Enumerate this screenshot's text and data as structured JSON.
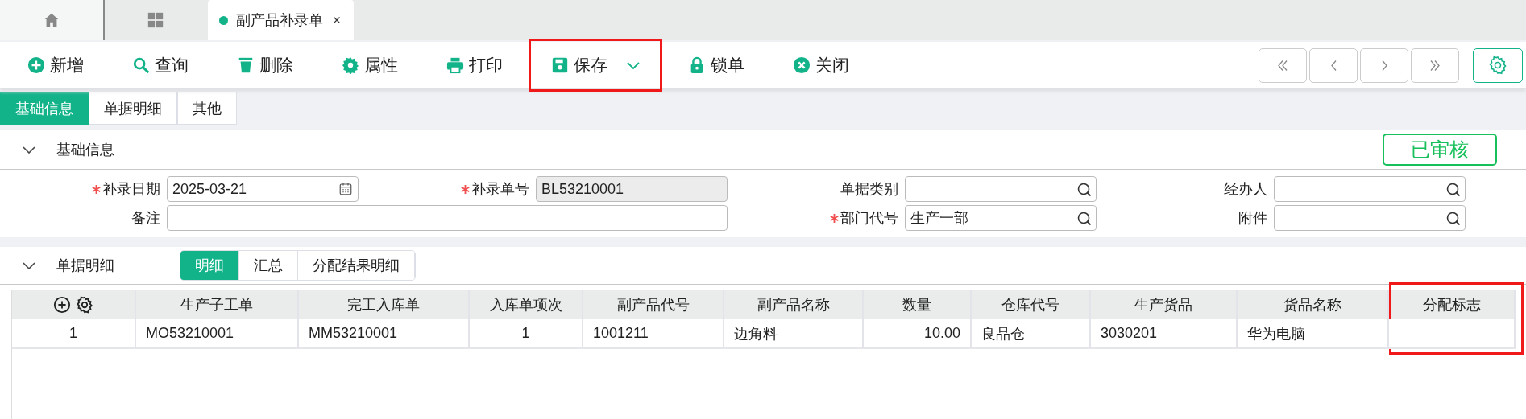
{
  "tabs": [
    {
      "kind": "home",
      "selected": false
    },
    {
      "kind": "grid",
      "selected": false
    },
    {
      "kind": "page",
      "label": "副产品补录单",
      "selected": true
    }
  ],
  "toolbar": [
    {
      "kind": "add",
      "label": "新增"
    },
    {
      "kind": "search",
      "label": "查询"
    },
    {
      "kind": "delete",
      "label": "删除"
    },
    {
      "kind": "properties",
      "label": "属性"
    },
    {
      "kind": "print",
      "label": "打印"
    },
    {
      "kind": "save",
      "label": "保存",
      "dropdown": true,
      "highlighted": true
    },
    {
      "kind": "lock",
      "label": "锁单"
    },
    {
      "kind": "close",
      "label": "关闭"
    }
  ],
  "nav_buttons": [
    {
      "kind": "first"
    },
    {
      "kind": "prev"
    },
    {
      "kind": "next"
    },
    {
      "kind": "last"
    }
  ],
  "section_tabs": [
    {
      "label": "基础信息",
      "selected": true
    },
    {
      "label": "单据明细",
      "selected": false
    },
    {
      "label": "其他",
      "selected": false
    }
  ],
  "basic_info": {
    "title": "基础信息",
    "expanded": true,
    "status": "已审核",
    "fields": [
      {
        "label": "补录日期",
        "required": true,
        "kind": "date",
        "value": "2025-03-21"
      },
      {
        "label": "补录单号",
        "required": true,
        "kind": "readonly",
        "value": "BL53210001"
      },
      {
        "label": "单据类别",
        "required": false,
        "kind": "lookup"
      },
      {
        "label": "经办人",
        "required": false,
        "kind": "lookup"
      },
      {
        "label": "备注",
        "required": false,
        "kind": "text",
        "wide": true
      },
      {
        "label": "部门代号",
        "required": true,
        "kind": "lookup",
        "value": "生产一部"
      },
      {
        "label": "附件",
        "required": false,
        "kind": "lookup"
      }
    ]
  },
  "details": {
    "title": "单据明细",
    "expanded": true,
    "tabs": [
      {
        "label": "明细",
        "selected": true
      },
      {
        "label": "汇总",
        "selected": false
      },
      {
        "label": "分配结果明细",
        "selected": false
      }
    ],
    "table": {
      "columns": [
        {
          "kind": "tools"
        },
        {
          "label": "生产子工单"
        },
        {
          "label": "完工入库单"
        },
        {
          "label": "入库单项次"
        },
        {
          "label": "副产品代号"
        },
        {
          "label": "副产品名称"
        },
        {
          "label": "数量"
        },
        {
          "label": "仓库代号"
        },
        {
          "label": "生产货品"
        },
        {
          "label": "货品名称"
        },
        {
          "label": "分配标志",
          "highlighted": true
        }
      ],
      "rows": [
        [
          "1",
          "MO53210001",
          "MM53210001",
          "1",
          "1001211",
          "边角料",
          "10.00",
          "良品仓",
          "3030201",
          "华为电脑",
          ""
        ]
      ]
    }
  }
}
